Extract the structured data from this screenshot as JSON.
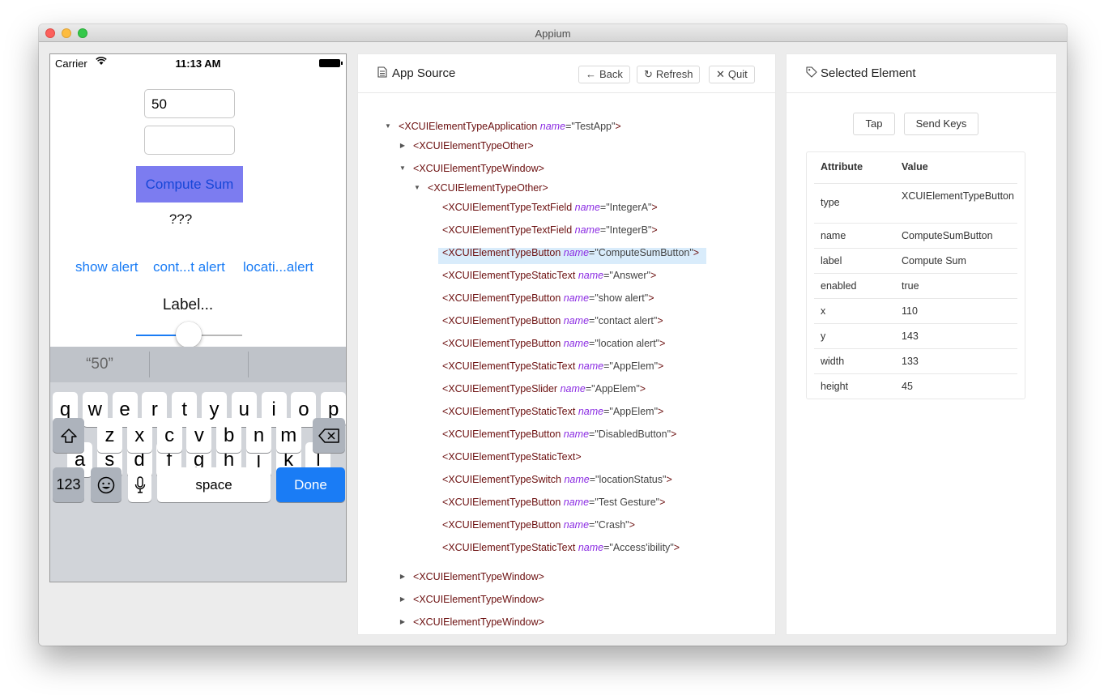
{
  "window": {
    "title": "Appium"
  },
  "device": {
    "status_bar": {
      "carrier": "Carrier",
      "time": "11:13 AM",
      "wifi_icon": "wifi-icon",
      "battery_icon": "battery-icon"
    },
    "field_a_value": "50",
    "field_b_value": "",
    "compute_button": "Compute Sum",
    "answer": "???",
    "alert_links": [
      "show alert",
      "cont...t alert",
      "locati...alert"
    ],
    "label": "Label...",
    "slider_value": 0.5,
    "keyboard": {
      "suggestions": [
        "“50”",
        "",
        ""
      ],
      "row1": [
        "q",
        "w",
        "e",
        "r",
        "t",
        "y",
        "u",
        "i",
        "o",
        "p"
      ],
      "row2": [
        "a",
        "s",
        "d",
        "f",
        "g",
        "h",
        "j",
        "k",
        "l"
      ],
      "row3": [
        "z",
        "x",
        "c",
        "v",
        "b",
        "n",
        "m"
      ],
      "shift_icon": "shift-icon",
      "delete_icon": "backspace-icon",
      "numbers_key": "123",
      "emoji_icon": "emoji-icon",
      "mic_icon": "microphone-icon",
      "space_key": "space",
      "done_key": "Done"
    }
  },
  "app_source": {
    "title": "App Source",
    "buttons": {
      "back": "Back",
      "refresh": "Refresh",
      "quit": "Quit"
    },
    "tree": [
      {
        "depth": 0,
        "toggle": "expanded",
        "tag": "XCUIElementTypeApplication",
        "attr": "name",
        "value": "TestApp"
      },
      {
        "depth": 1,
        "toggle": "collapsed",
        "tag": "XCUIElementTypeOther"
      },
      {
        "depth": 1,
        "toggle": "expanded",
        "tag": "XCUIElementTypeWindow"
      },
      {
        "depth": 2,
        "toggle": "expanded",
        "tag": "XCUIElementTypeOther"
      },
      {
        "depth": 3,
        "tag": "XCUIElementTypeTextField",
        "attr": "name",
        "value": "IntegerA"
      },
      {
        "depth": 3,
        "tag": "XCUIElementTypeTextField",
        "attr": "name",
        "value": "IntegerB"
      },
      {
        "depth": 3,
        "tag": "XCUIElementTypeButton",
        "attr": "name",
        "value": "ComputeSumButton",
        "selected": true
      },
      {
        "depth": 3,
        "tag": "XCUIElementTypeStaticText",
        "attr": "name",
        "value": "Answer"
      },
      {
        "depth": 3,
        "tag": "XCUIElementTypeButton",
        "attr": "name",
        "value": "show alert"
      },
      {
        "depth": 3,
        "tag": "XCUIElementTypeButton",
        "attr": "name",
        "value": "contact alert"
      },
      {
        "depth": 3,
        "tag": "XCUIElementTypeButton",
        "attr": "name",
        "value": "location alert"
      },
      {
        "depth": 3,
        "tag": "XCUIElementTypeStaticText",
        "attr": "name",
        "value": "AppElem"
      },
      {
        "depth": 3,
        "tag": "XCUIElementTypeSlider",
        "attr": "name",
        "value": "AppElem"
      },
      {
        "depth": 3,
        "tag": "XCUIElementTypeStaticText",
        "attr": "name",
        "value": "AppElem"
      },
      {
        "depth": 3,
        "tag": "XCUIElementTypeButton",
        "attr": "name",
        "value": "DisabledButton"
      },
      {
        "depth": 3,
        "tag": "XCUIElementTypeStaticText"
      },
      {
        "depth": 3,
        "tag": "XCUIElementTypeSwitch",
        "attr": "name",
        "value": "locationStatus"
      },
      {
        "depth": 3,
        "tag": "XCUIElementTypeButton",
        "attr": "name",
        "value": "Test Gesture"
      },
      {
        "depth": 3,
        "tag": "XCUIElementTypeButton",
        "attr": "name",
        "value": "Crash"
      },
      {
        "depth": 3,
        "tag": "XCUIElementTypeStaticText",
        "attr": "name",
        "value": "Access'ibility"
      },
      {
        "depth": 1,
        "toggle": "collapsed",
        "tag": "XCUIElementTypeWindow"
      },
      {
        "depth": 1,
        "toggle": "collapsed",
        "tag": "XCUIElementTypeWindow"
      },
      {
        "depth": 1,
        "toggle": "collapsed",
        "tag": "XCUIElementTypeWindow"
      }
    ]
  },
  "selected_element": {
    "title": "Selected Element",
    "buttons": {
      "tap": "Tap",
      "send_keys": "Send Keys"
    },
    "headers": {
      "attribute": "Attribute",
      "value": "Value"
    },
    "attributes": [
      {
        "name": "type",
        "value": "XCUIElementTypeButton"
      },
      {
        "name": "name",
        "value": "ComputeSumButton"
      },
      {
        "name": "label",
        "value": "Compute Sum"
      },
      {
        "name": "enabled",
        "value": "true"
      },
      {
        "name": "x",
        "value": "110"
      },
      {
        "name": "y",
        "value": "143"
      },
      {
        "name": "width",
        "value": "133"
      },
      {
        "name": "height",
        "value": "45"
      }
    ]
  }
}
